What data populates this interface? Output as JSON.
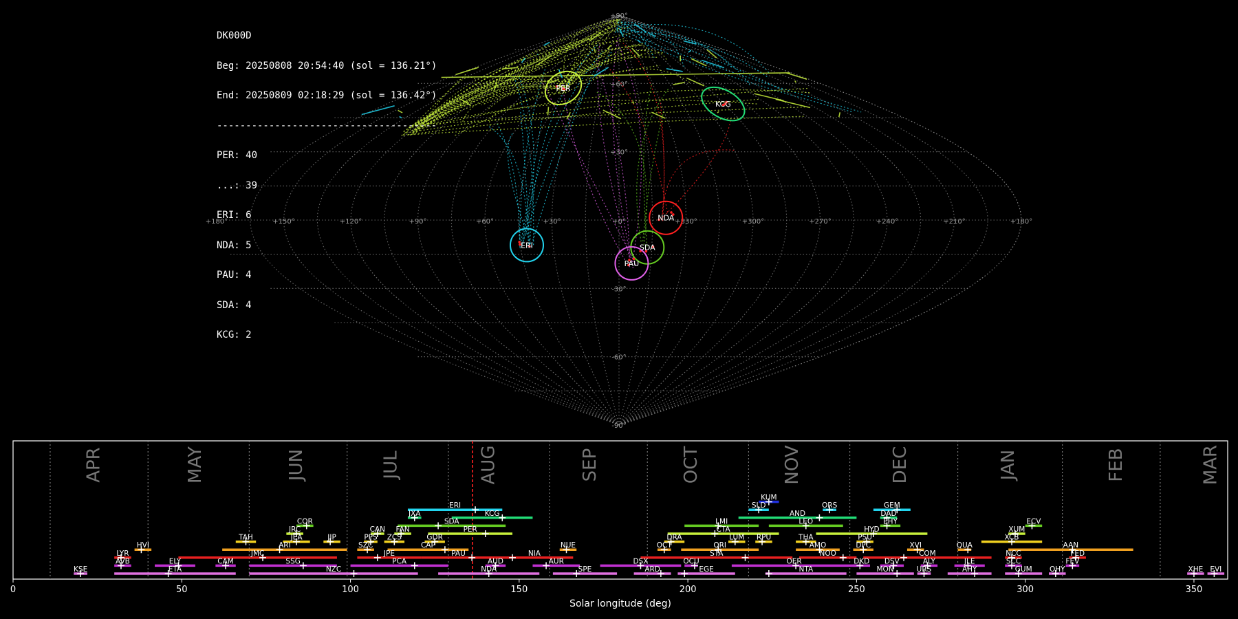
{
  "station": "DK000D",
  "begin": "Beg: 20250808 20:54:40 (sol = 136.21°)",
  "end": "End: 20250809 02:18:29 (sol = 136.42°)",
  "separator": "--------------------------------------",
  "counts": [
    "PER: 40",
    "...: 39",
    "ERI: 6",
    "NDA: 5",
    "PAU: 4",
    "SDA: 4",
    "KCG: 2"
  ],
  "colors": {
    "background": "#000000",
    "grid": "#8a8a8a",
    "frame": "#ffffff",
    "PER": "#c8f03c",
    "ERI": "#22d4ee",
    "NDA": "#ff2020",
    "SDA": "#66cc22",
    "PAU": "#e060e8",
    "KCG": "#22dd77",
    "sporadic": "#c8f03c"
  },
  "sky_map": {
    "projection": "sinusoidal",
    "lon_ticks": [
      "+180°",
      "+150°",
      "+120°",
      "+90°",
      "+60°",
      "+30°",
      "+0°",
      "+330°",
      "+300°",
      "+270°",
      "+240°",
      "+210°",
      "+180°"
    ],
    "lat_ticks": [
      "+90°",
      "+60°",
      "+30°",
      "-30°",
      "-60°",
      "-90°"
    ],
    "radiants": [
      {
        "code": "PER",
        "ra": 47,
        "dec": 58,
        "color": "#c8f03c"
      },
      {
        "code": "KCG",
        "ra": 286,
        "dec": 51,
        "color": "#22dd77"
      },
      {
        "code": "NDA",
        "ra": 339,
        "dec": 1,
        "color": "#ff2020"
      },
      {
        "code": "ERI",
        "ra": 42,
        "dec": -11,
        "color": "#22d4ee"
      },
      {
        "code": "SDA",
        "ra": 347,
        "dec": -12,
        "color": "#66cc22"
      },
      {
        "code": "PAU",
        "ra": 354,
        "dec": -19,
        "color": "#e060e8"
      }
    ]
  },
  "chart_data": {
    "type": "timeline",
    "xlabel": "Solar longitude (deg)",
    "xlim": [
      0,
      360
    ],
    "x_ticks": [
      0,
      50,
      100,
      150,
      200,
      250,
      300,
      350
    ],
    "current_sol": 136.2,
    "months": [
      {
        "name": "APR",
        "sol": 24
      },
      {
        "name": "MAY",
        "sol": 54
      },
      {
        "name": "JUN",
        "sol": 84
      },
      {
        "name": "JUL",
        "sol": 112
      },
      {
        "name": "AUG",
        "sol": 141
      },
      {
        "name": "SEP",
        "sol": 171
      },
      {
        "name": "OCT",
        "sol": 201
      },
      {
        "name": "NOV",
        "sol": 231
      },
      {
        "name": "DEC",
        "sol": 263
      },
      {
        "name": "JAN",
        "sol": 295
      },
      {
        "name": "FEB",
        "sol": 327
      },
      {
        "name": "MAR",
        "sol": 355
      }
    ],
    "month_boundaries": [
      11,
      40,
      70,
      99,
      129,
      159,
      188,
      218,
      248,
      280,
      311,
      340
    ],
    "showers": [
      {
        "code": "KUM",
        "start": 221,
        "end": 227,
        "peak": 224,
        "row": 10,
        "color": "#2030e0"
      },
      {
        "code": "ERI",
        "start": 117,
        "end": 145,
        "peak": 137,
        "row": 9,
        "color": "#22d4ee"
      },
      {
        "code": "SLD",
        "start": 218,
        "end": 224,
        "peak": 221,
        "row": 9,
        "color": "#22d4ee"
      },
      {
        "code": "ORS",
        "start": 240,
        "end": 244,
        "peak": 242,
        "row": 9,
        "color": "#22d4ee"
      },
      {
        "code": "GEM",
        "start": 255,
        "end": 266,
        "peak": 262,
        "row": 9,
        "color": "#22d4ee"
      },
      {
        "code": "JXA",
        "start": 117,
        "end": 121,
        "peak": 119,
        "row": 8,
        "color": "#22dd77"
      },
      {
        "code": "KCG",
        "start": 130,
        "end": 154,
        "peak": 145,
        "row": 8,
        "color": "#22dd77"
      },
      {
        "code": "AND",
        "start": 215,
        "end": 250,
        "peak": 239,
        "row": 8,
        "color": "#22dd77"
      },
      {
        "code": "DAD",
        "start": 257,
        "end": 262,
        "peak": 259,
        "row": 8,
        "color": "#22dd77"
      },
      {
        "code": "COR",
        "start": 84,
        "end": 89,
        "peak": 87,
        "row": 7,
        "color": "#66cc22"
      },
      {
        "code": "SDA",
        "start": 114,
        "end": 146,
        "peak": 126,
        "row": 7,
        "color": "#66cc22"
      },
      {
        "code": "LMI",
        "start": 199,
        "end": 221,
        "peak": 209,
        "row": 7,
        "color": "#66cc22"
      },
      {
        "code": "LEO",
        "start": 224,
        "end": 246,
        "peak": 235,
        "row": 7,
        "color": "#66cc22"
      },
      {
        "code": "EHY",
        "start": 257,
        "end": 263,
        "peak": 259,
        "row": 7,
        "color": "#66cc22"
      },
      {
        "code": "ECV",
        "start": 300,
        "end": 305,
        "peak": 302,
        "row": 7,
        "color": "#66cc22"
      },
      {
        "code": "JRC",
        "start": 81,
        "end": 86,
        "peak": 84,
        "row": 6,
        "color": "#c8f03c"
      },
      {
        "code": "CAN",
        "start": 106,
        "end": 110,
        "peak": 108,
        "row": 6,
        "color": "#c8f03c"
      },
      {
        "code": "FAN",
        "start": 113,
        "end": 118,
        "peak": 115,
        "row": 6,
        "color": "#c8f03c"
      },
      {
        "code": "PER",
        "start": 123,
        "end": 148,
        "peak": 140,
        "row": 6,
        "color": "#c8f03c"
      },
      {
        "code": "CTA",
        "start": 194,
        "end": 227,
        "peak": 208,
        "row": 6,
        "color": "#c8f03c"
      },
      {
        "code": "HYD",
        "start": 238,
        "end": 271,
        "peak": 255,
        "row": 6,
        "color": "#c8f03c"
      },
      {
        "code": "XUM",
        "start": 295,
        "end": 300,
        "peak": 297,
        "row": 6,
        "color": "#c8f03c"
      },
      {
        "code": "TAH",
        "start": 66,
        "end": 72,
        "peak": 69,
        "row": 5,
        "color": "#f0d020"
      },
      {
        "code": "JEA",
        "start": 80,
        "end": 88,
        "peak": 84,
        "row": 5,
        "color": "#f0d020"
      },
      {
        "code": "JIP",
        "start": 92,
        "end": 97,
        "peak": 94,
        "row": 5,
        "color": "#f0d020"
      },
      {
        "code": "PPS",
        "start": 104,
        "end": 108,
        "peak": 106,
        "row": 5,
        "color": "#f0d020"
      },
      {
        "code": "ZCS",
        "start": 110,
        "end": 116,
        "peak": 113,
        "row": 5,
        "color": "#f0d020"
      },
      {
        "code": "GDR",
        "start": 122,
        "end": 128,
        "peak": 125,
        "row": 5,
        "color": "#f0d020"
      },
      {
        "code": "DRA",
        "start": 193,
        "end": 199,
        "peak": 195,
        "row": 5,
        "color": "#f0d020"
      },
      {
        "code": "LUM",
        "start": 212,
        "end": 217,
        "peak": 214,
        "row": 5,
        "color": "#f0d020"
      },
      {
        "code": "RPU",
        "start": 220,
        "end": 225,
        "peak": 222,
        "row": 5,
        "color": "#f0d020"
      },
      {
        "code": "THA",
        "start": 232,
        "end": 238,
        "peak": 235,
        "row": 5,
        "color": "#f0d020"
      },
      {
        "code": "PSU",
        "start": 250,
        "end": 255,
        "peak": 253,
        "row": 5,
        "color": "#f0d020"
      },
      {
        "code": "XCB",
        "start": 287,
        "end": 305,
        "peak": 296,
        "row": 5,
        "color": "#f0d020"
      },
      {
        "code": "HVI",
        "start": 36,
        "end": 41,
        "peak": 38,
        "row": 4,
        "color": "#f0a020"
      },
      {
        "code": "ARI",
        "start": 62,
        "end": 99,
        "peak": 79,
        "row": 4,
        "color": "#f0a020"
      },
      {
        "code": "SZC",
        "start": 102,
        "end": 107,
        "peak": 105,
        "row": 4,
        "color": "#f0a020"
      },
      {
        "code": "CAP",
        "start": 111,
        "end": 135,
        "peak": 128,
        "row": 4,
        "color": "#f0a020"
      },
      {
        "code": "NUE",
        "start": 162,
        "end": 167,
        "peak": 164,
        "row": 4,
        "color": "#f0a020"
      },
      {
        "code": "OCT",
        "start": 191,
        "end": 195,
        "peak": 193,
        "row": 4,
        "color": "#f0a020"
      },
      {
        "code": "ORI",
        "start": 198,
        "end": 221,
        "peak": 209,
        "row": 4,
        "color": "#f0a020"
      },
      {
        "code": "AMO",
        "start": 232,
        "end": 245,
        "peak": 239,
        "row": 4,
        "color": "#f0a020"
      },
      {
        "code": "DPC",
        "start": 249,
        "end": 255,
        "peak": 252,
        "row": 4,
        "color": "#f0a020"
      },
      {
        "code": "XVI",
        "start": 265,
        "end": 270,
        "peak": 268,
        "row": 4,
        "color": "#f0a020"
      },
      {
        "code": "QUA",
        "start": 280,
        "end": 284,
        "peak": 283,
        "row": 4,
        "color": "#f0a020"
      },
      {
        "code": "AAN",
        "start": 295,
        "end": 332,
        "peak": 314,
        "row": 4,
        "color": "#f0a020"
      },
      {
        "code": "LYR",
        "start": 30,
        "end": 35,
        "peak": 32,
        "row": 3,
        "color": "#e82020"
      },
      {
        "code": "JMC",
        "start": 49,
        "end": 96,
        "peak": 74,
        "row": 3,
        "color": "#e82020"
      },
      {
        "code": "JPE",
        "start": 102,
        "end": 121,
        "peak": 108,
        "row": 3,
        "color": "#e82020"
      },
      {
        "code": "PAU",
        "start": 121,
        "end": 143,
        "peak": 136,
        "row": 3,
        "color": "#e82020"
      },
      {
        "code": "NIA",
        "start": 143,
        "end": 166,
        "peak": 148,
        "row": 3,
        "color": "#e82020"
      },
      {
        "code": "STA",
        "start": 186,
        "end": 231,
        "peak": 217,
        "row": 3,
        "color": "#e82020"
      },
      {
        "code": "NOO",
        "start": 233,
        "end": 250,
        "peak": 246,
        "row": 3,
        "color": "#e82020"
      },
      {
        "code": "COM",
        "start": 252,
        "end": 290,
        "peak": 264,
        "row": 3,
        "color": "#e82020"
      },
      {
        "code": "NCC",
        "start": 294,
        "end": 299,
        "peak": 296,
        "row": 3,
        "color": "#e82020"
      },
      {
        "code": "FED",
        "start": 313,
        "end": 318,
        "peak": 315,
        "row": 3,
        "color": "#e82020"
      },
      {
        "code": "AVB",
        "start": 30,
        "end": 35,
        "peak": 32,
        "row": 2,
        "color": "#c030d0"
      },
      {
        "code": "ELY",
        "start": 42,
        "end": 54,
        "peak": 49,
        "row": 2,
        "color": "#c030d0"
      },
      {
        "code": "CAM",
        "start": 60,
        "end": 66,
        "peak": 63,
        "row": 2,
        "color": "#c030d0"
      },
      {
        "code": "SSG",
        "start": 70,
        "end": 96,
        "peak": 86,
        "row": 2,
        "color": "#c030d0"
      },
      {
        "code": "PCA",
        "start": 100,
        "end": 129,
        "peak": 119,
        "row": 2,
        "color": "#c030d0"
      },
      {
        "code": "AUD",
        "start": 140,
        "end": 146,
        "peak": 143,
        "row": 2,
        "color": "#c030d0"
      },
      {
        "code": "AUR",
        "start": 154,
        "end": 168,
        "peak": 158,
        "row": 2,
        "color": "#c030d0"
      },
      {
        "code": "DSX",
        "start": 174,
        "end": 198,
        "peak": 186,
        "row": 2,
        "color": "#c030d0"
      },
      {
        "code": "OCU",
        "start": 199,
        "end": 203,
        "peak": 202,
        "row": 2,
        "color": "#c030d0"
      },
      {
        "code": "OER",
        "start": 213,
        "end": 250,
        "peak": 232,
        "row": 2,
        "color": "#c030d0"
      },
      {
        "code": "DKD",
        "start": 249,
        "end": 254,
        "peak": 251,
        "row": 2,
        "color": "#c030d0"
      },
      {
        "code": "DSV",
        "start": 257,
        "end": 264,
        "peak": 261,
        "row": 2,
        "color": "#c030d0"
      },
      {
        "code": "ALY",
        "start": 269,
        "end": 274,
        "peak": 271,
        "row": 2,
        "color": "#c030d0"
      },
      {
        "code": "JLE",
        "start": 279,
        "end": 288,
        "peak": 283,
        "row": 2,
        "color": "#c030d0"
      },
      {
        "code": "SCC",
        "start": 294,
        "end": 299,
        "peak": 296,
        "row": 2,
        "color": "#c030d0"
      },
      {
        "code": "FEV",
        "start": 312,
        "end": 316,
        "peak": 314,
        "row": 2,
        "color": "#c030d0"
      },
      {
        "code": "KSE",
        "start": 18,
        "end": 22,
        "peak": 20,
        "row": 1,
        "color": "#e070e0"
      },
      {
        "code": "ETA",
        "start": 30,
        "end": 66,
        "peak": 46,
        "row": 1,
        "color": "#e070e0"
      },
      {
        "code": "NZC",
        "start": 70,
        "end": 120,
        "peak": 101,
        "row": 1,
        "color": "#e070e0"
      },
      {
        "code": "NDA",
        "start": 126,
        "end": 156,
        "peak": 141,
        "row": 1,
        "color": "#e070e0"
      },
      {
        "code": "SPE",
        "start": 160,
        "end": 179,
        "peak": 167,
        "row": 1,
        "color": "#e070e0"
      },
      {
        "code": "ARD",
        "start": 184,
        "end": 195,
        "peak": 192,
        "row": 1,
        "color": "#e070e0"
      },
      {
        "code": "EGE",
        "start": 197,
        "end": 214,
        "peak": 199,
        "row": 1,
        "color": "#e070e0"
      },
      {
        "code": "NTA",
        "start": 223,
        "end": 247,
        "peak": 224,
        "row": 1,
        "color": "#e070e0"
      },
      {
        "code": "MON",
        "start": 250,
        "end": 267,
        "peak": 262,
        "row": 1,
        "color": "#e070e0"
      },
      {
        "code": "URS",
        "start": 268,
        "end": 272,
        "peak": 270,
        "row": 1,
        "color": "#e070e0"
      },
      {
        "code": "AHY",
        "start": 277,
        "end": 290,
        "peak": 285,
        "row": 1,
        "color": "#e070e0"
      },
      {
        "code": "GUM",
        "start": 294,
        "end": 305,
        "peak": 298,
        "row": 1,
        "color": "#e070e0"
      },
      {
        "code": "OHY",
        "start": 307,
        "end": 312,
        "peak": 309,
        "row": 1,
        "color": "#e070e0"
      },
      {
        "code": "XHE",
        "start": 348,
        "end": 353,
        "peak": 350,
        "row": 1,
        "color": "#e070e0"
      },
      {
        "code": "EVI",
        "start": 354,
        "end": 359,
        "peak": 356,
        "row": 1,
        "color": "#e070e0"
      }
    ]
  }
}
